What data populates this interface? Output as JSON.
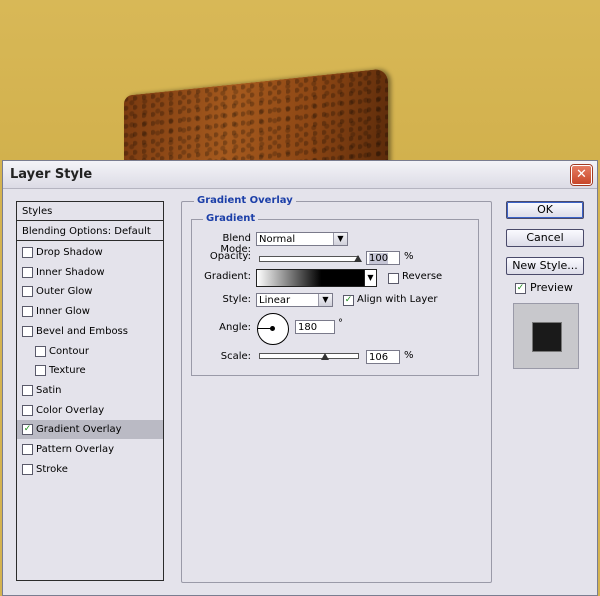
{
  "dialog": {
    "title": "Layer Style",
    "close_glyph": "✕"
  },
  "styles_list": {
    "header": "Styles",
    "blending": "Blending Options: Default",
    "items": [
      {
        "label": "Drop Shadow",
        "checked": false,
        "indent": false
      },
      {
        "label": "Inner Shadow",
        "checked": false,
        "indent": false
      },
      {
        "label": "Outer Glow",
        "checked": false,
        "indent": false
      },
      {
        "label": "Inner Glow",
        "checked": false,
        "indent": false
      },
      {
        "label": "Bevel and Emboss",
        "checked": false,
        "indent": false
      },
      {
        "label": "Contour",
        "checked": false,
        "indent": true
      },
      {
        "label": "Texture",
        "checked": false,
        "indent": true
      },
      {
        "label": "Satin",
        "checked": false,
        "indent": false
      },
      {
        "label": "Color Overlay",
        "checked": false,
        "indent": false
      },
      {
        "label": "Gradient Overlay",
        "checked": true,
        "indent": false,
        "selected": true
      },
      {
        "label": "Pattern Overlay",
        "checked": false,
        "indent": false
      },
      {
        "label": "Stroke",
        "checked": false,
        "indent": false
      }
    ]
  },
  "panel": {
    "section_title": "Gradient Overlay",
    "group_title": "Gradient",
    "blend_mode_label": "Blend Mode:",
    "blend_mode_value": "Normal",
    "opacity_label": "Opacity:",
    "opacity_value": "100",
    "opacity_unit": "%",
    "gradient_label": "Gradient:",
    "reverse_label": "Reverse",
    "reverse_checked": false,
    "style_label": "Style:",
    "style_value": "Linear",
    "align_label": "Align with Layer",
    "align_checked": true,
    "angle_label": "Angle:",
    "angle_value": "180",
    "angle_unit": "°",
    "scale_label": "Scale:",
    "scale_value": "106",
    "scale_unit": "%",
    "dropdown_arrow": "▼"
  },
  "buttons": {
    "ok": "OK",
    "cancel": "Cancel",
    "new_style": "New Style...",
    "preview_label": "Preview",
    "preview_checked": true
  },
  "colors": {
    "canvas_bg": "#d4b350",
    "group_title": "#1c3fa8",
    "check": "#1a8a1a"
  }
}
